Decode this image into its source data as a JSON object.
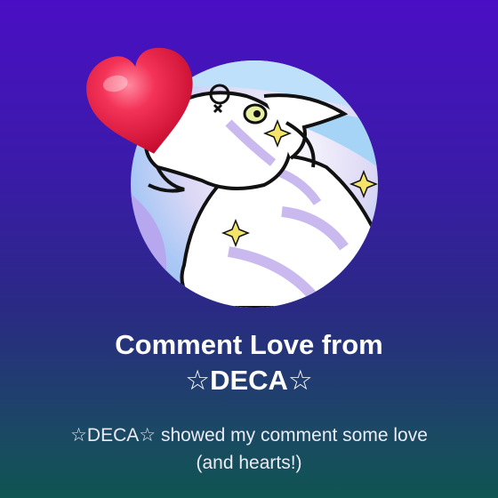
{
  "notification": {
    "title_line1": "Comment Love from",
    "title_line2": "☆DECA☆",
    "message": "☆DECA☆ showed my comment some love (and hearts!)"
  },
  "icons": {
    "reaction": "heart-icon",
    "avatar": "dragon-avatar"
  },
  "colors": {
    "background_top": "#4a0fc4",
    "background_bottom": "#0f5552",
    "heart": "#e8163c",
    "text": "#ffffff"
  }
}
